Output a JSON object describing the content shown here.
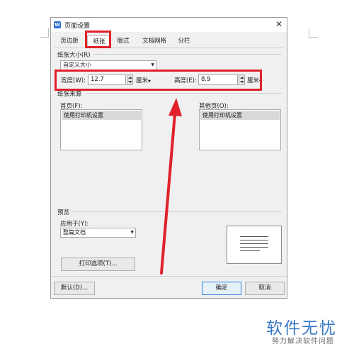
{
  "dialog": {
    "title": "页面设置",
    "app_icon_letter": "W",
    "close_glyph": "✕"
  },
  "tabs": [
    {
      "label": "页边距"
    },
    {
      "label": "纸张",
      "selected": true
    },
    {
      "label": "版式"
    },
    {
      "label": "文档网格"
    },
    {
      "label": "分栏"
    }
  ],
  "paper_size": {
    "section_label": "纸张大小(R)",
    "selected_size": "自定义大小",
    "width_label": "宽度(W):",
    "width_value": "12.7",
    "width_unit": "厘米",
    "height_label": "高度(E):",
    "height_value": "8.9",
    "height_unit": "厘米"
  },
  "paper_source": {
    "section_label": "纸张来源",
    "first_page_label": "首页(F):",
    "first_page_item": "使用打印机设置",
    "other_pages_label": "其他页(O):",
    "other_pages_item": "使用打印机设置"
  },
  "preview": {
    "section_label": "预览",
    "apply_to_label": "应用于(Y):",
    "apply_to_value": "整篇文档"
  },
  "buttons": {
    "print_options": "打印选项(T)...",
    "default": "默认(D)...",
    "ok": "确定",
    "cancel": "取消"
  },
  "watermark": {
    "brand": "软件无忧",
    "slogan": "努力解决软件问题"
  },
  "colors": {
    "annotation_red": "#e0212a",
    "accent_blue": "#2e7bd6"
  }
}
